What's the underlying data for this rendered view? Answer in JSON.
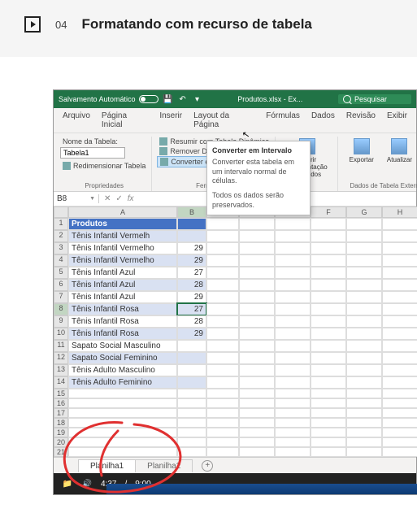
{
  "lesson": {
    "number": "04",
    "title": "Formatando com recurso de tabela"
  },
  "titlebar": {
    "autosave": "Salvamento Automático",
    "filename": "Produtos.xlsx - Ex...",
    "search_placeholder": "Pesquisar"
  },
  "menu": {
    "arquivo": "Arquivo",
    "pagina_inicial": "Página Inicial",
    "inserir": "Inserir",
    "layout": "Layout da Página",
    "formulas": "Fórmulas",
    "dados": "Dados",
    "revisao": "Revisão",
    "exibir": "Exibir"
  },
  "ribbon": {
    "nome_tabela_label": "Nome da Tabela:",
    "nome_tabela_value": "Tabela1",
    "redimensionar": "Redimensionar Tabela",
    "propriedades": "Propriedades",
    "resumir": "Resumir com Tabela Dinâmica",
    "remover_dup": "Remover Duplicatas",
    "converter": "Converter em Intervalo",
    "ferramentas": "Ferramentas",
    "inserir_seg": "Inserir Segmentação de Dados",
    "exportar": "Exportar",
    "atualizar": "Atualizar",
    "dados_externa": "Dados de Tabela Externa"
  },
  "tooltip": {
    "title": "Converter em Intervalo",
    "line1": "Converter esta tabela em um intervalo normal de células.",
    "line2": "Todos os dados serão preservados."
  },
  "namebox": "B8",
  "columns": [
    "",
    "A",
    "B",
    "C",
    "D",
    "E",
    "F",
    "G",
    "H"
  ],
  "header_row": {
    "a": "Produtos"
  },
  "rows": [
    {
      "n": "1"
    },
    {
      "n": "2",
      "a": "Tênis Infantil Vermelh"
    },
    {
      "n": "3",
      "a": "Tênis Infantil Vermelho",
      "b": "29"
    },
    {
      "n": "4",
      "a": "Tênis Infantil Vermelho",
      "b": "29"
    },
    {
      "n": "5",
      "a": "Tênis Infantil Azul",
      "b": "27"
    },
    {
      "n": "6",
      "a": "Tênis Infantil Azul",
      "b": "28"
    },
    {
      "n": "7",
      "a": "Tênis Infantil Azul",
      "b": "29"
    },
    {
      "n": "8",
      "a": "Tênis Infantil Rosa",
      "b": "27"
    },
    {
      "n": "9",
      "a": "Tênis Infantil Rosa",
      "b": "28"
    },
    {
      "n": "10",
      "a": "Tênis Infantil Rosa",
      "b": "29"
    },
    {
      "n": "11",
      "a": "Sapato Social Masculino"
    },
    {
      "n": "12",
      "a": "Sapato Social Feminino"
    },
    {
      "n": "13",
      "a": "Tênis Adulto Masculino"
    },
    {
      "n": "14",
      "a": "Tênis Adulto Feminino"
    },
    {
      "n": "15"
    },
    {
      "n": "16"
    },
    {
      "n": "17"
    },
    {
      "n": "18"
    },
    {
      "n": "19"
    },
    {
      "n": "20"
    },
    {
      "n": "21"
    }
  ],
  "sheets": {
    "s1": "Planilha1",
    "s2": "Planilha2"
  },
  "video": {
    "current": "4:37",
    "sep": "/",
    "total": "9:00"
  }
}
